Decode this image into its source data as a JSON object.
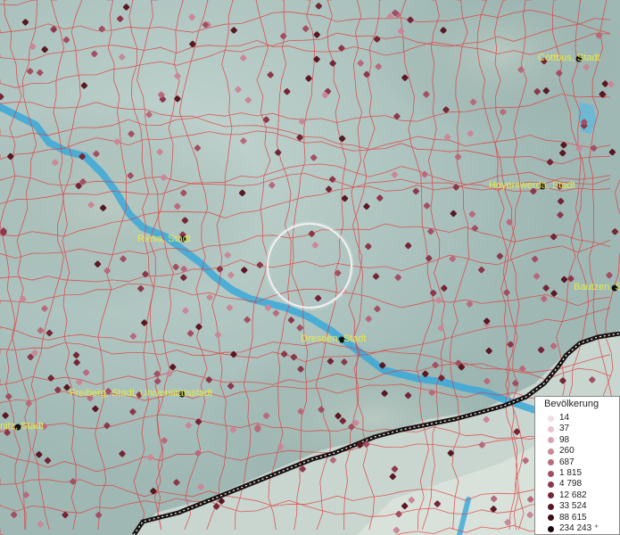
{
  "legend": {
    "title": "Bevölkerung",
    "items": [
      {
        "label": "14",
        "color": "#f4dde3"
      },
      {
        "label": "37",
        "color": "#e9c3cd"
      },
      {
        "label": "98",
        "color": "#d9a4b1"
      },
      {
        "label": "260",
        "color": "#c98797"
      },
      {
        "label": "687",
        "color": "#b86a7c"
      },
      {
        "label": "1 815",
        "color": "#a34f63"
      },
      {
        "label": "4 798",
        "color": "#8c384b"
      },
      {
        "label": "12 682",
        "color": "#742636"
      },
      {
        "label": "33 524",
        "color": "#5a1823"
      },
      {
        "label": "88 615",
        "color": "#3d0e14"
      },
      {
        "label": "234 243 ⁺",
        "color": "#1a0507"
      }
    ]
  },
  "cities": [
    {
      "label": "Cottbus, Stadt"
    },
    {
      "label": "Hoyerswerda, Stadt"
    },
    {
      "label": "Riesa, Stadt"
    },
    {
      "label": "Bautzen, St"
    },
    {
      "label": "Dresden, Stadt"
    },
    {
      "label": "Freiberg, Stadt, Universitätsstadt"
    },
    {
      "label": "nitz, Stadt"
    }
  ],
  "colors": {
    "terrain": "#9fb8b4",
    "boundaries": "#e0393b",
    "river": "#3aa8d8",
    "border": "#1b1313"
  }
}
